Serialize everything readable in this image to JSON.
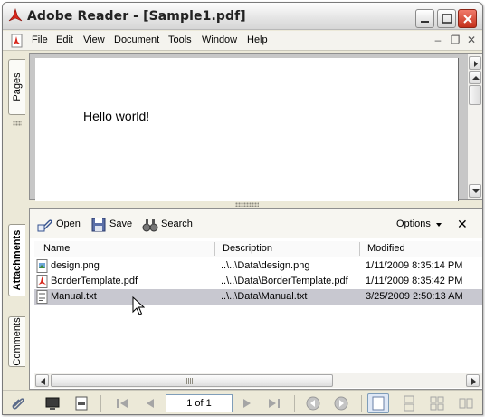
{
  "window": {
    "title": "Adobe Reader - [Sample1.pdf]"
  },
  "menu": {
    "items": [
      "File",
      "Edit",
      "View",
      "Document",
      "Tools",
      "Window",
      "Help"
    ],
    "mdi_controls": [
      "–",
      "❐",
      "✕"
    ]
  },
  "side_tabs": {
    "pages": "Pages",
    "attachments": "Attachments",
    "comments": "Comments"
  },
  "document": {
    "text": "Hello world!"
  },
  "attachments": {
    "toolbar": {
      "open": "Open",
      "save": "Save",
      "search": "Search",
      "options": "Options",
      "close": "✕"
    },
    "columns": [
      "Name",
      "Description",
      "Modified"
    ],
    "rows": [
      {
        "name": "design.png",
        "description": "..\\..\\Data\\design.png",
        "modified": "1/11/2009 8:35:14 PM",
        "icon": "image-file-icon",
        "selected": false
      },
      {
        "name": "BorderTemplate.pdf",
        "description": "..\\..\\Data\\BorderTemplate.pdf",
        "modified": "1/11/2009 8:35:42 PM",
        "icon": "pdf-file-icon",
        "selected": false
      },
      {
        "name": "Manual.txt",
        "description": "..\\..\\Data\\Manual.txt",
        "modified": "3/25/2009 2:50:13 AM",
        "icon": "text-file-icon",
        "selected": true
      }
    ]
  },
  "statusbar": {
    "page_indicator": "1 of 1"
  },
  "colors": {
    "chrome": "#ece9d8",
    "selection": "#c8c8d0",
    "accent_red": "#c4301c"
  }
}
